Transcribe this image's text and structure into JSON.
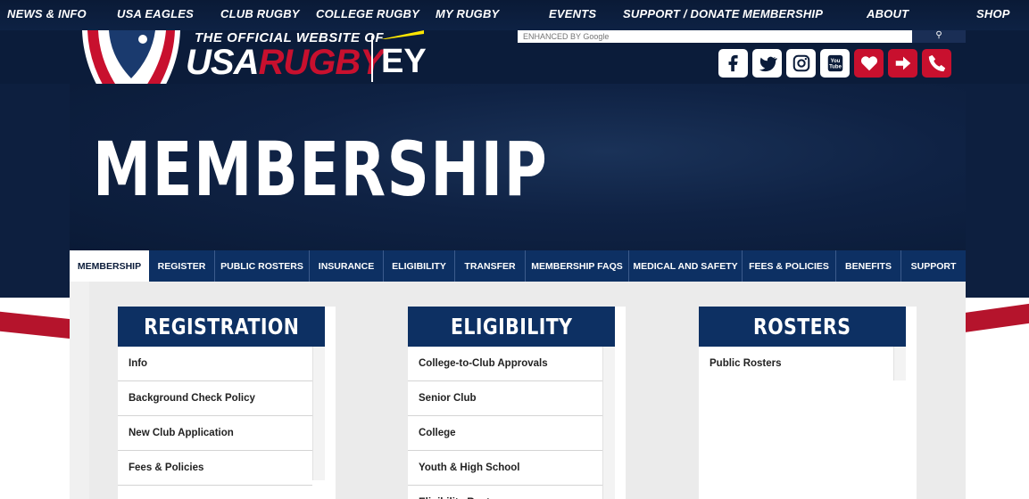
{
  "topnav": {
    "items": [
      "NEWS & INFO",
      "USA EAGLES",
      "CLUB RUGBY",
      "COLLEGE RUGBY",
      "MY RUGBY",
      "EVENTS",
      "SUPPORT / DONATE",
      "MEMBERSHIP",
      "ABOUT",
      "SHOP"
    ]
  },
  "header": {
    "tagline": "THE OFFICIAL WEBSITE OF",
    "brand_usa": "USA",
    "brand_rugby": "RUGBY",
    "sponsor": "EY",
    "search_placeholder": "ENHANCED BY Google"
  },
  "social": [
    "facebook-icon",
    "twitter-icon",
    "instagram-icon",
    "youtube-icon",
    "donate-heart-icon",
    "login-icon",
    "phone-icon"
  ],
  "hero": {
    "title": "MEMBERSHIP"
  },
  "tabs": [
    "MEMBERSHIP",
    "REGISTER",
    "PUBLIC ROSTERS",
    "INSURANCE",
    "ELIGIBILITY",
    "TRANSFER",
    "MEMBERSHIP FAQS",
    "MEDICAL AND SAFETY",
    "FEES & POLICIES",
    "BENEFITS",
    "SUPPORT"
  ],
  "columns": [
    {
      "title": "REGISTRATION",
      "items": [
        "Info",
        "Background Check Policy",
        "New Club Application",
        "Fees & Policies"
      ]
    },
    {
      "title": "ELIGIBILITY",
      "items": [
        "College-to-Club Approvals",
        "Senior Club",
        "College",
        "Youth & High School",
        "Eligibility Rosters"
      ]
    },
    {
      "title": "ROSTERS",
      "items": [
        "Public Rosters"
      ]
    }
  ],
  "colors": {
    "navy": "#0d3063",
    "dark": "#0b1c3a",
    "red": "#c8102e"
  }
}
